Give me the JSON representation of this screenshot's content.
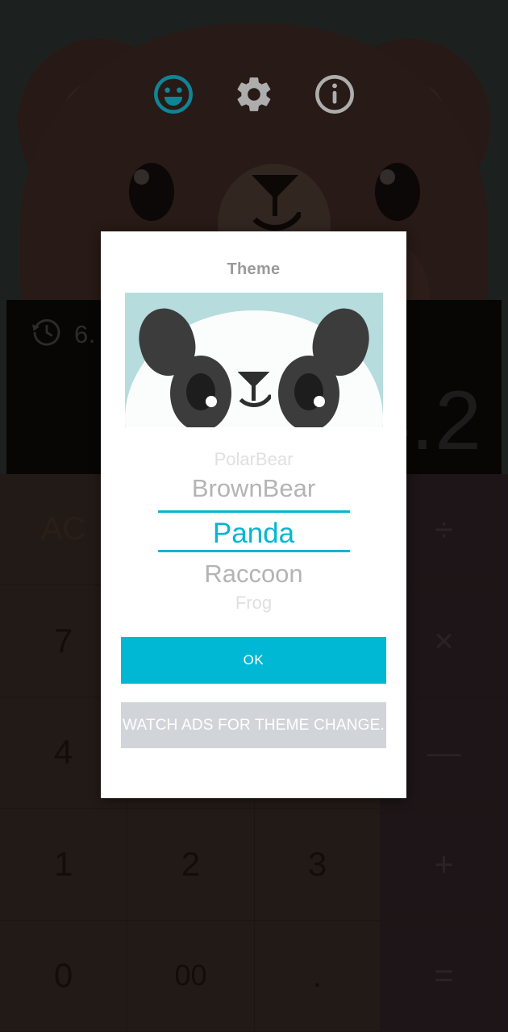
{
  "app": {
    "background_color": "#2a3230",
    "accent_color": "#00b8d4",
    "theme_active": "BrownBear"
  },
  "toolbar": {
    "items": [
      {
        "icon": "smiley-icon",
        "label": "Theme",
        "active": true,
        "color": "#19c3dd"
      },
      {
        "icon": "gear-icon",
        "label": "Settings",
        "active": false,
        "color": "#ffffff"
      },
      {
        "icon": "info-icon",
        "label": "Info",
        "active": false,
        "color": "#ffffff"
      }
    ]
  },
  "calculator": {
    "history_value": "6.",
    "history_icon": "history-icon",
    "result": "4.2",
    "keys": [
      {
        "label": "AC",
        "type": "clear"
      },
      {
        "label": "",
        "type": "blank"
      },
      {
        "label": "",
        "type": "blank"
      },
      {
        "label": "÷",
        "type": "operator"
      },
      {
        "label": "7",
        "type": "digit"
      },
      {
        "label": "",
        "type": "blank"
      },
      {
        "label": "",
        "type": "blank"
      },
      {
        "label": "×",
        "type": "operator"
      },
      {
        "label": "4",
        "type": "digit"
      },
      {
        "label": "",
        "type": "blank"
      },
      {
        "label": "",
        "type": "blank"
      },
      {
        "label": "—",
        "type": "operator"
      },
      {
        "label": "1",
        "type": "digit"
      },
      {
        "label": "2",
        "type": "digit"
      },
      {
        "label": "3",
        "type": "digit"
      },
      {
        "label": "+",
        "type": "operator"
      },
      {
        "label": "0",
        "type": "digit"
      },
      {
        "label": "00",
        "type": "digit"
      },
      {
        "label": ".",
        "type": "digit"
      },
      {
        "label": "=",
        "type": "operator"
      }
    ]
  },
  "dialog": {
    "title": "Theme",
    "preview": {
      "name": "panda-preview-image",
      "background_color": "#b6dcdd",
      "face_color": "#fbfdfd",
      "feature_color": "#3c3c3c"
    },
    "picker": {
      "selected_index": 2,
      "options": [
        {
          "label": "PolarBear",
          "distance": "far"
        },
        {
          "label": "BrownBear",
          "distance": "near"
        },
        {
          "label": "Panda",
          "distance": "selected"
        },
        {
          "label": "Raccoon",
          "distance": "near"
        },
        {
          "label": "Frog",
          "distance": "far"
        }
      ]
    },
    "ok_label": "OK",
    "watch_ads_label": "WATCH ADS FOR THEME CHANGE."
  }
}
